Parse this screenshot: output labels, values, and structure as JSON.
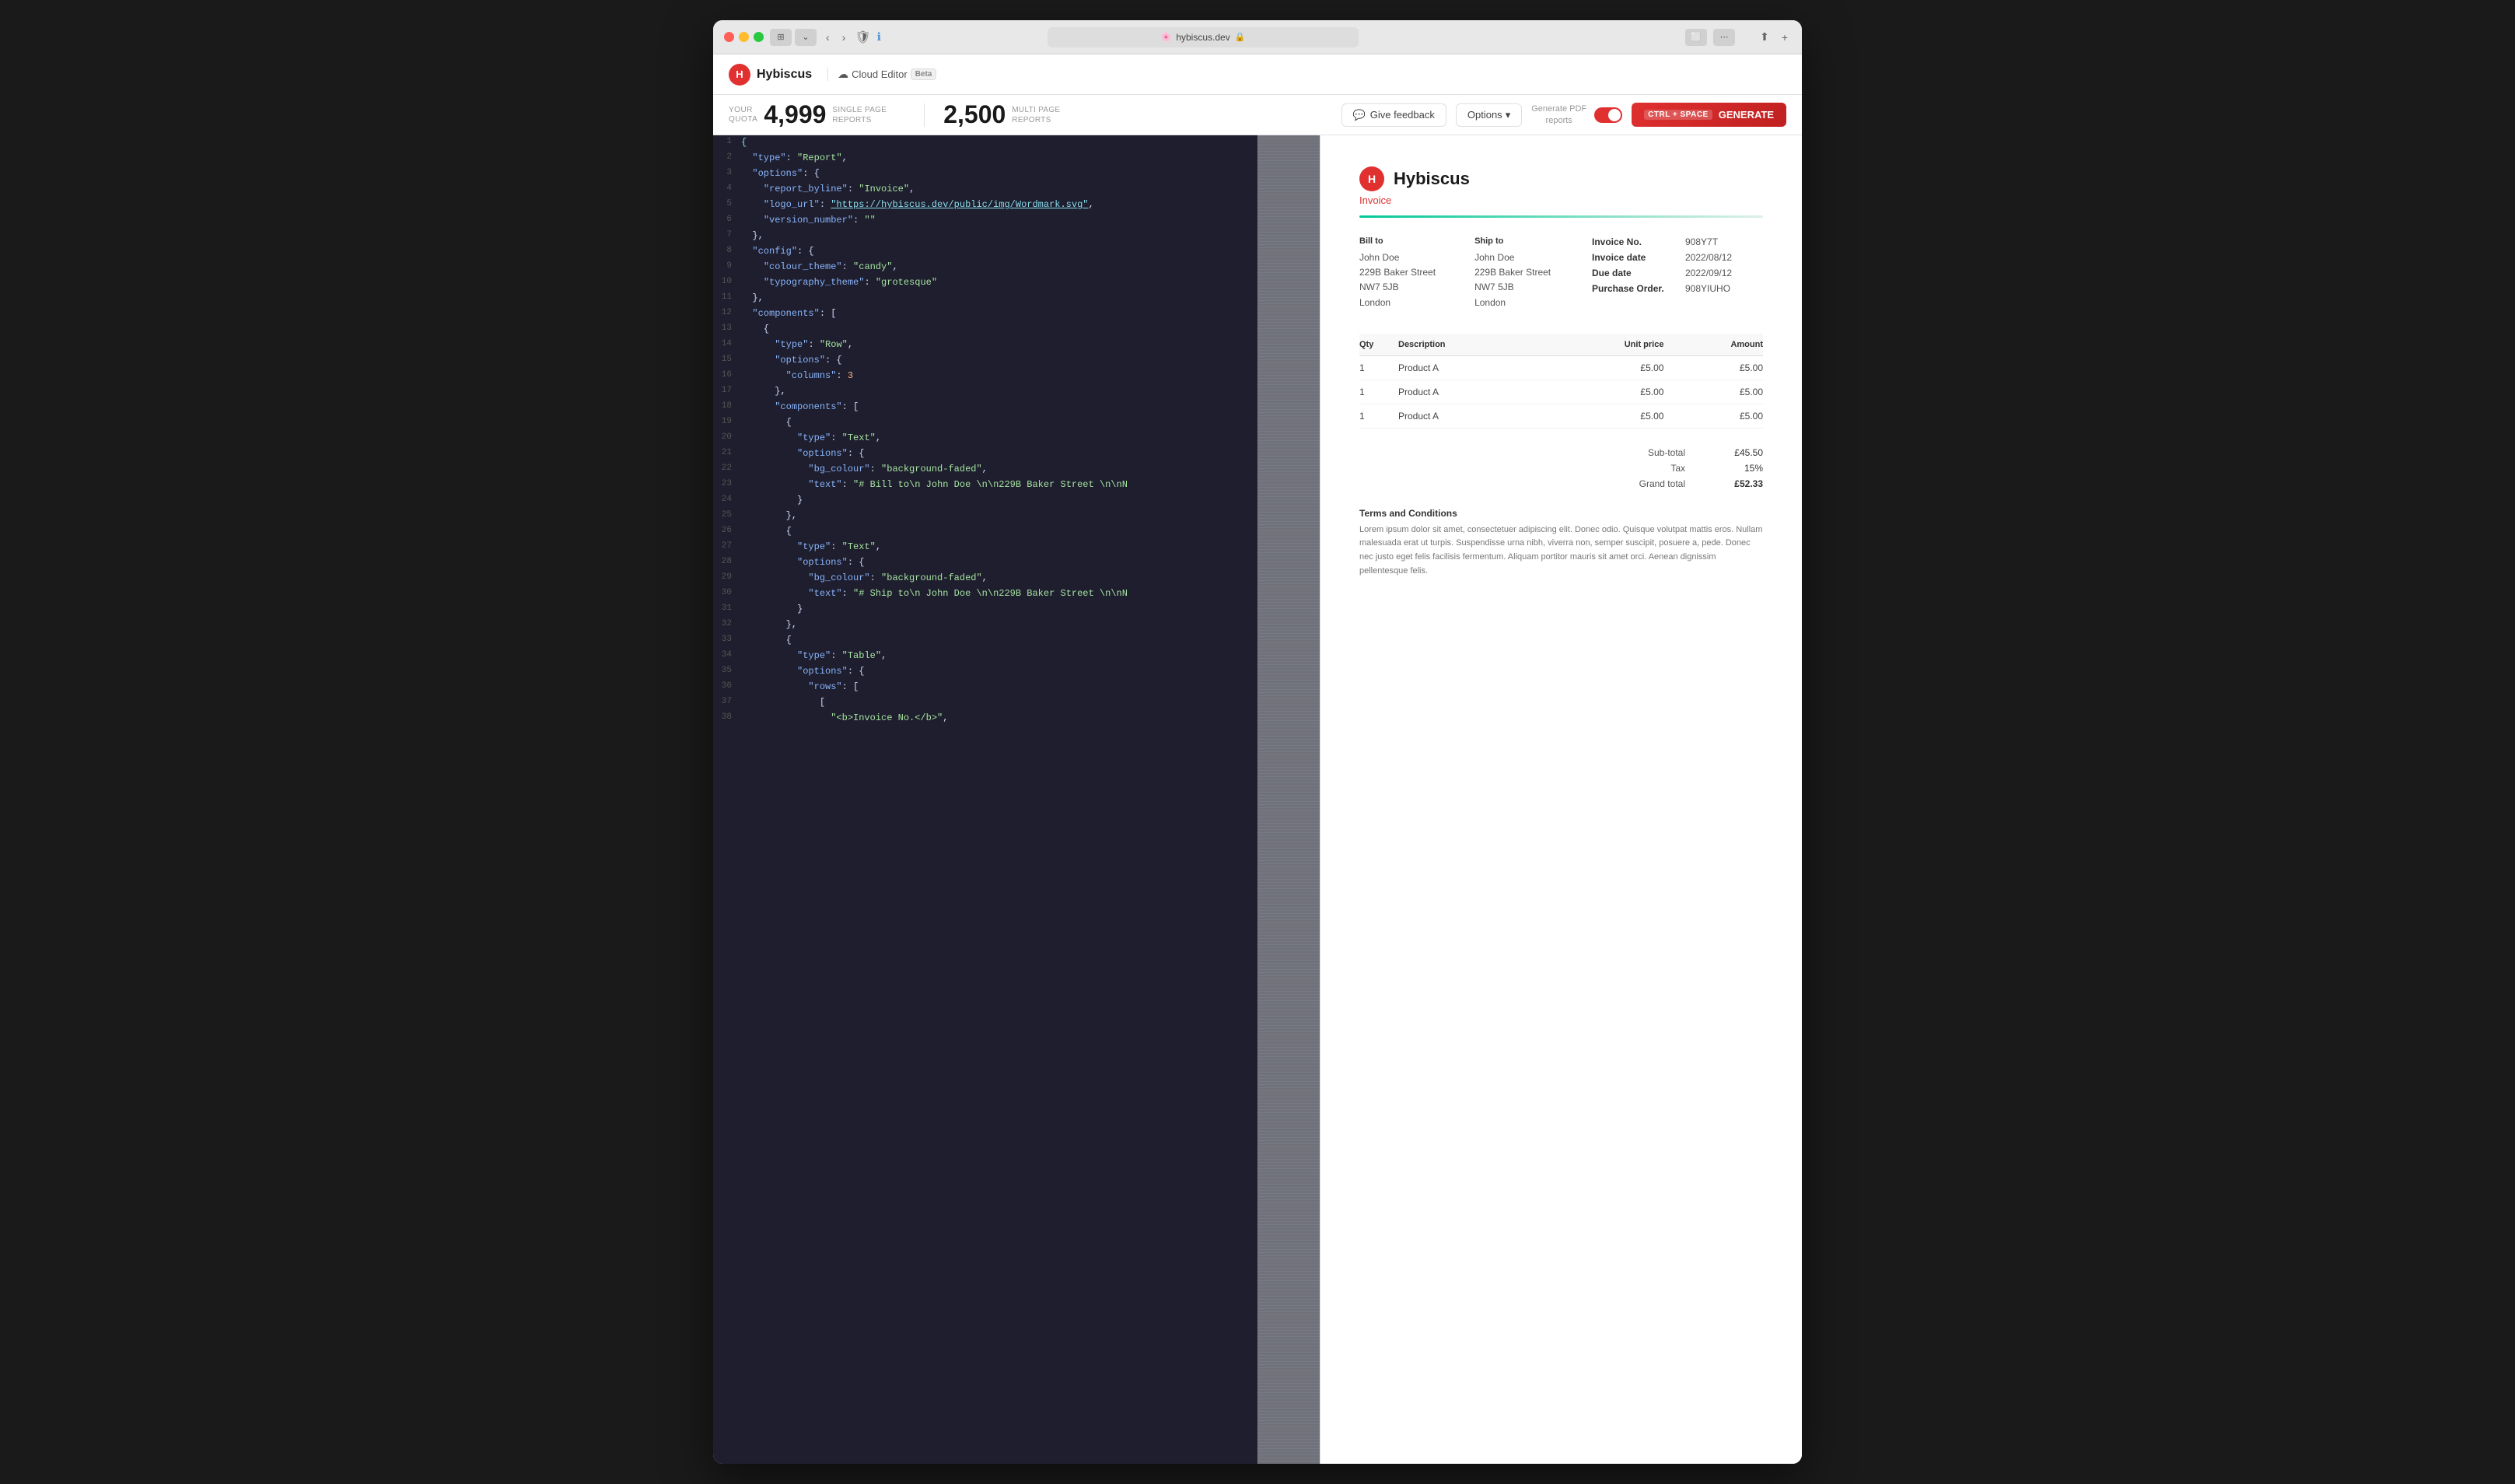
{
  "window": {
    "title": "hybiscus.dev",
    "url": "hybiscus.dev"
  },
  "app": {
    "logo_letter": "H",
    "name": "Hybiscus",
    "cloud_icon": "☁",
    "cloud_label": "Cloud Editor",
    "beta_label": "Beta"
  },
  "toolbar": {
    "quota_label": "YOUR\nQUOTA",
    "single_count": "4,999",
    "single_label": "SINGLE PAGE\nREPORTS",
    "multi_count": "2,500",
    "multi_label": "MULTI PAGE\nREPORTS",
    "feedback_label": "Give feedback",
    "options_label": "Options",
    "pdf_label": "Generate PDF\nreports",
    "generate_shortcut": "CTRL + SPACE",
    "generate_label": "GENERATE"
  },
  "code": {
    "lines": [
      {
        "num": 1,
        "content": "{"
      },
      {
        "num": 2,
        "content": "  \"type\": \"Report\","
      },
      {
        "num": 3,
        "content": "  \"options\": {"
      },
      {
        "num": 4,
        "content": "    \"report_byline\": \"Invoice\","
      },
      {
        "num": 5,
        "content": "    \"logo_url\": \"https://hybiscus.dev/public/img/Wordmark.svg\","
      },
      {
        "num": 6,
        "content": "    \"version_number\": \"\""
      },
      {
        "num": 7,
        "content": "  },"
      },
      {
        "num": 8,
        "content": "  \"config\": {"
      },
      {
        "num": 9,
        "content": "    \"colour_theme\": \"candy\","
      },
      {
        "num": 10,
        "content": "    \"typography_theme\": \"grotesque\""
      },
      {
        "num": 11,
        "content": "  },"
      },
      {
        "num": 12,
        "content": "  \"components\": ["
      },
      {
        "num": 13,
        "content": "    {"
      },
      {
        "num": 14,
        "content": "      \"type\": \"Row\","
      },
      {
        "num": 15,
        "content": "      \"options\": {"
      },
      {
        "num": 16,
        "content": "        \"columns\": 3"
      },
      {
        "num": 17,
        "content": "      },"
      },
      {
        "num": 18,
        "content": "      \"components\": ["
      },
      {
        "num": 19,
        "content": "        {"
      },
      {
        "num": 20,
        "content": "          \"type\": \"Text\","
      },
      {
        "num": 21,
        "content": "          \"options\": {"
      },
      {
        "num": 22,
        "content": "            \"bg_colour\": \"background-faded\","
      },
      {
        "num": 23,
        "content": "            \"text\": \"# Bill to\\n John Doe \\n\\n229B Baker Street \\n\\nN"
      },
      {
        "num": 24,
        "content": "          }"
      },
      {
        "num": 25,
        "content": "        },"
      },
      {
        "num": 26,
        "content": "        {"
      },
      {
        "num": 27,
        "content": "          \"type\": \"Text\","
      },
      {
        "num": 28,
        "content": "          \"options\": {"
      },
      {
        "num": 29,
        "content": "            \"bg_colour\": \"background-faded\","
      },
      {
        "num": 30,
        "content": "            \"text\": \"# Ship to\\n John Doe \\n\\n229B Baker Street \\n\\nN"
      },
      {
        "num": 31,
        "content": "          }"
      },
      {
        "num": 32,
        "content": "        },"
      },
      {
        "num": 33,
        "content": "        {"
      },
      {
        "num": 34,
        "content": "          \"type\": \"Table\","
      },
      {
        "num": 35,
        "content": "          \"options\": {"
      },
      {
        "num": 36,
        "content": "            \"rows\": ["
      },
      {
        "num": 37,
        "content": "              ["
      },
      {
        "num": 38,
        "content": "                \"<b>Invoice No.</b>\","
      }
    ]
  },
  "invoice": {
    "company": "Hybiscus",
    "logo_letter": "H",
    "type": "Invoice",
    "bill_to": {
      "title": "Bill to",
      "name": "John Doe",
      "address1": "229B Baker Street",
      "address2": "NW7 5JB",
      "city": "London"
    },
    "ship_to": {
      "title": "Ship to",
      "name": "John Doe",
      "address1": "229B Baker Street",
      "address2": "NW7 5JB",
      "city": "London"
    },
    "details": [
      {
        "label": "Invoice No.",
        "value": "908Y7T"
      },
      {
        "label": "Invoice date",
        "value": "2022/08/12"
      },
      {
        "label": "Due date",
        "value": "2022/09/12"
      },
      {
        "label": "Purchase Order.",
        "value": "908YIUHO"
      }
    ],
    "table": {
      "headers": [
        "Qty",
        "Description",
        "Unit price",
        "Amount"
      ],
      "rows": [
        [
          "1",
          "Product A",
          "£5.00",
          "£5.00"
        ],
        [
          "1",
          "Product A",
          "£5.00",
          "£5.00"
        ],
        [
          "1",
          "Product A",
          "£5.00",
          "£5.00"
        ]
      ]
    },
    "subtotal_label": "Sub-total",
    "subtotal_value": "£45.50",
    "tax_label": "Tax",
    "tax_value": "15%",
    "grand_label": "Grand total",
    "grand_value": "£52.33",
    "terms_title": "Terms and Conditions",
    "terms_text": "Lorem ipsum dolor sit amet, consectetuer adipiscing elit. Donec odio. Quisque volutpat mattis eros. Nullam malesuada erat ut turpis. Suspendisse urna nibh, viverra non, semper suscipit, posuere a, pede. Donec nec justo eget felis facilisis fermentum. Aliquam portitor mauris sit amet orci. Aenean dignissim pellentesque felis."
  }
}
